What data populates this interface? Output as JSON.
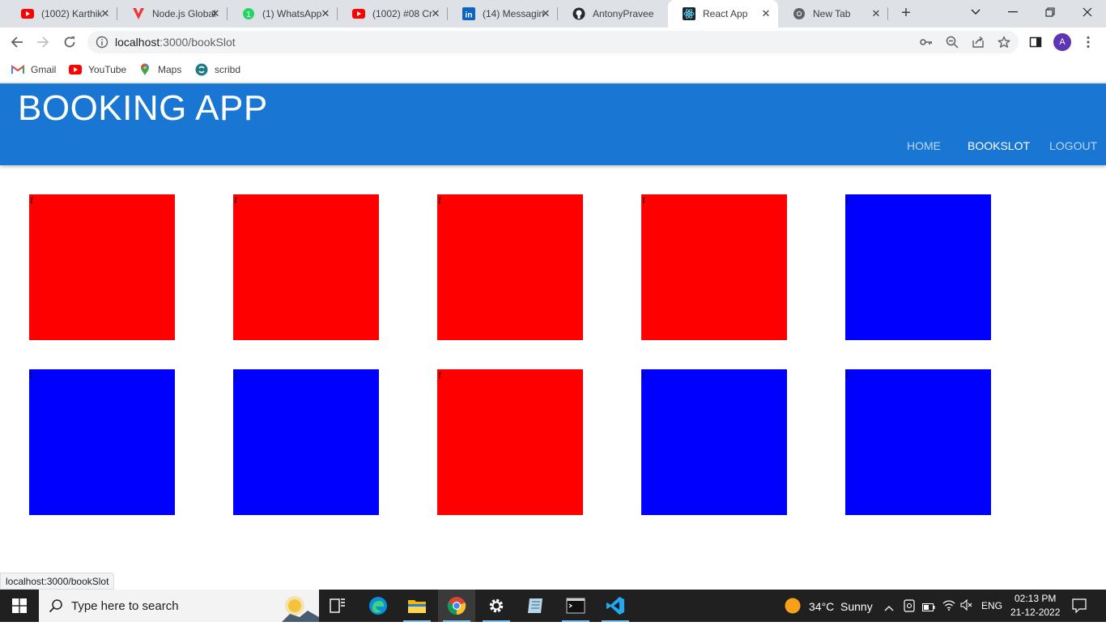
{
  "browser": {
    "tabs": [
      {
        "title": "(1002) Karthik",
        "icon": "youtube-icon",
        "color": "#ff0000"
      },
      {
        "title": "Node.js Global",
        "icon": "vivaldi-v-icon",
        "color": "#ef3939"
      },
      {
        "title": "(1) WhatsApp",
        "icon": "whatsapp-icon",
        "color": "#25d366"
      },
      {
        "title": "(1002) #08 Cr",
        "icon": "youtube-icon",
        "color": "#ff0000"
      },
      {
        "title": "(14) Messagin",
        "icon": "linkedin-icon",
        "color": "#0a66c2"
      },
      {
        "title": "AntonyPravee",
        "icon": "github-icon",
        "color": "#24292f"
      },
      {
        "title": "React App",
        "icon": "react-icon",
        "color": "#61dafb",
        "active": true
      },
      {
        "title": "New Tab",
        "icon": "chrome-icon",
        "color": "#5f6368"
      }
    ],
    "url_host": "localhost",
    "url_path": ":3000/bookSlot",
    "avatar_letter": "A",
    "bookmarks": [
      {
        "label": "Gmail",
        "icon": "gmail-icon"
      },
      {
        "label": "YouTube",
        "icon": "youtube-icon"
      },
      {
        "label": "Maps",
        "icon": "maps-pin-icon"
      },
      {
        "label": "scribd",
        "icon": "scribd-icon"
      }
    ],
    "status_url": "localhost:3000/bookSlot"
  },
  "app": {
    "brand": "BOOKING APP",
    "nav": [
      {
        "label": "HOME",
        "active": false
      },
      {
        "label": "BOOKSLOT",
        "active": true
      },
      {
        "label": "LOGOUT",
        "active": false
      }
    ],
    "colors": {
      "appbar": "#1976d2",
      "booked": "#ff0000",
      "free": "#0000ff"
    },
    "slots": [
      {
        "label": "f",
        "status": "booked"
      },
      {
        "label": "f",
        "status": "booked"
      },
      {
        "label": "f",
        "status": "booked"
      },
      {
        "label": "f",
        "status": "booked"
      },
      {
        "label": "t",
        "status": "free"
      },
      {
        "label": "t",
        "status": "free"
      },
      {
        "label": "t",
        "status": "free"
      },
      {
        "label": "f",
        "status": "booked"
      },
      {
        "label": "t",
        "status": "free"
      },
      {
        "label": "t",
        "status": "free"
      }
    ]
  },
  "taskbar": {
    "search_placeholder": "Type here to search",
    "weather_temp": "34°C",
    "weather_text": "Sunny",
    "language": "ENG",
    "time": "02:13 PM",
    "date": "21-12-2022"
  }
}
